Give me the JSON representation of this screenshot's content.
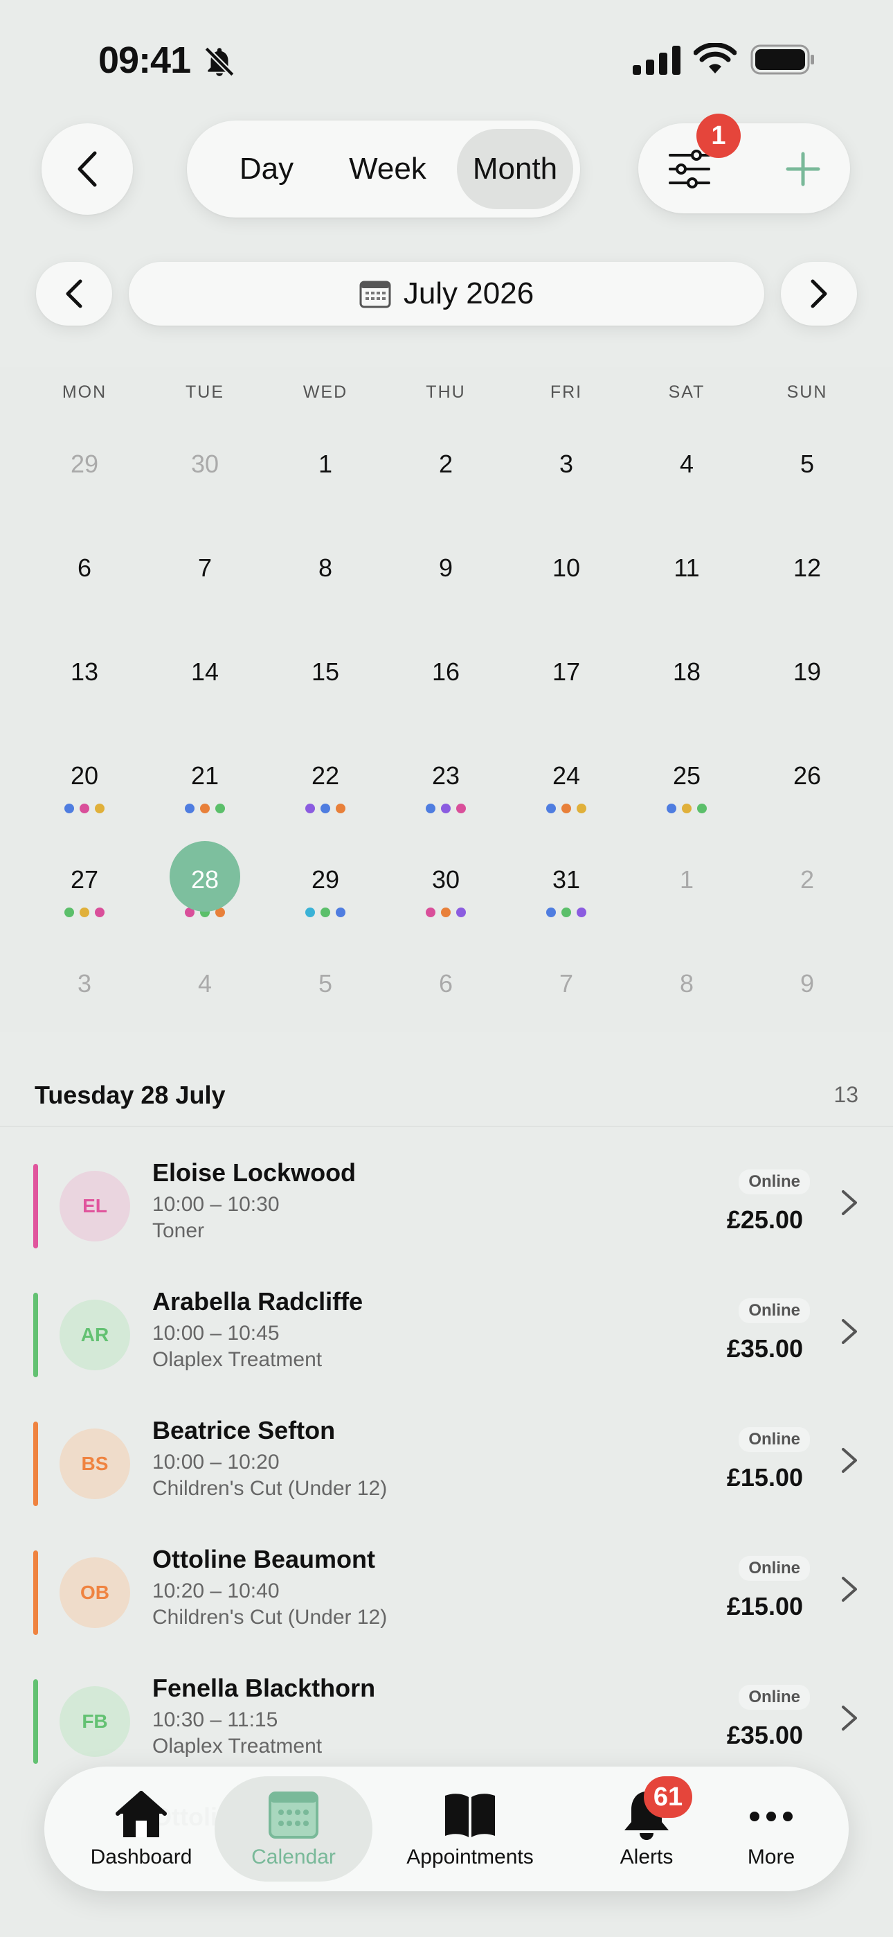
{
  "status": {
    "time": "09:41"
  },
  "toolbar": {
    "view_options": [
      "Day",
      "Week",
      "Month"
    ],
    "selected_view": "Month",
    "filter_badge": "1"
  },
  "month_nav": {
    "label": "July 2026"
  },
  "calendar": {
    "weekdays": [
      "MON",
      "TUE",
      "WED",
      "THU",
      "FRI",
      "SAT",
      "SUN"
    ],
    "weeks": [
      [
        "29",
        "30",
        "1",
        "2",
        "3",
        "4",
        "5"
      ],
      [
        "6",
        "7",
        "8",
        "9",
        "10",
        "11",
        "12"
      ],
      [
        "13",
        "14",
        "15",
        "16",
        "17",
        "18",
        "19"
      ],
      [
        "20",
        "21",
        "22",
        "23",
        "24",
        "25",
        "26"
      ],
      [
        "27",
        "28",
        "29",
        "30",
        "31",
        "1",
        "2"
      ],
      [
        "3",
        "4",
        "5",
        "6",
        "7",
        "8",
        "9"
      ]
    ],
    "selected_day": "28",
    "dot_colors": {
      "blue": "#4f7de0",
      "pink": "#d94f9a",
      "yellow": "#e0b03a",
      "orange": "#e8803a",
      "purple": "#8b5ce0",
      "green": "#5bbf6a",
      "cyan": "#3ab2d6"
    }
  },
  "agenda": {
    "heading": "Tuesday 28 July",
    "count": "13",
    "appointments": [
      {
        "initials": "EL",
        "name": "Eloise Lockwood",
        "time": "10:00 – 10:30",
        "service": "Toner",
        "channel": "Online",
        "price": "£25.00",
        "color": "#e0559d",
        "avatar_bg": "#ead5df"
      },
      {
        "initials": "AR",
        "name": "Arabella Radcliffe",
        "time": "10:00 – 10:45",
        "service": "Olaplex Treatment",
        "channel": "Online",
        "price": "£35.00",
        "color": "#63c172",
        "avatar_bg": "#d4e9d7"
      },
      {
        "initials": "BS",
        "name": "Beatrice Sefton",
        "time": "10:00 – 10:20",
        "service": "Children's Cut (Under 12)",
        "channel": "Online",
        "price": "£15.00",
        "color": "#ef8340",
        "avatar_bg": "#efdcca"
      },
      {
        "initials": "OB",
        "name": "Ottoline Beaumont",
        "time": "10:20 – 10:40",
        "service": "Children's Cut (Under 12)",
        "channel": "Online",
        "price": "£15.00",
        "color": "#ef8340",
        "avatar_bg": "#efdcca"
      },
      {
        "initials": "FB",
        "name": "Fenella Blackthorn",
        "time": "10:30 – 11:15",
        "service": "Olaplex Treatment",
        "channel": "Online",
        "price": "£35.00",
        "color": "#63c172",
        "avatar_bg": "#d4e9d7"
      },
      {
        "name": "Ottoline Caldwell"
      }
    ]
  },
  "tabbar": {
    "items": [
      "Dashboard",
      "Calendar",
      "Appointments",
      "Alerts",
      "More"
    ],
    "active": "Calendar",
    "alerts_badge": "61",
    "accent": "#79b999"
  }
}
